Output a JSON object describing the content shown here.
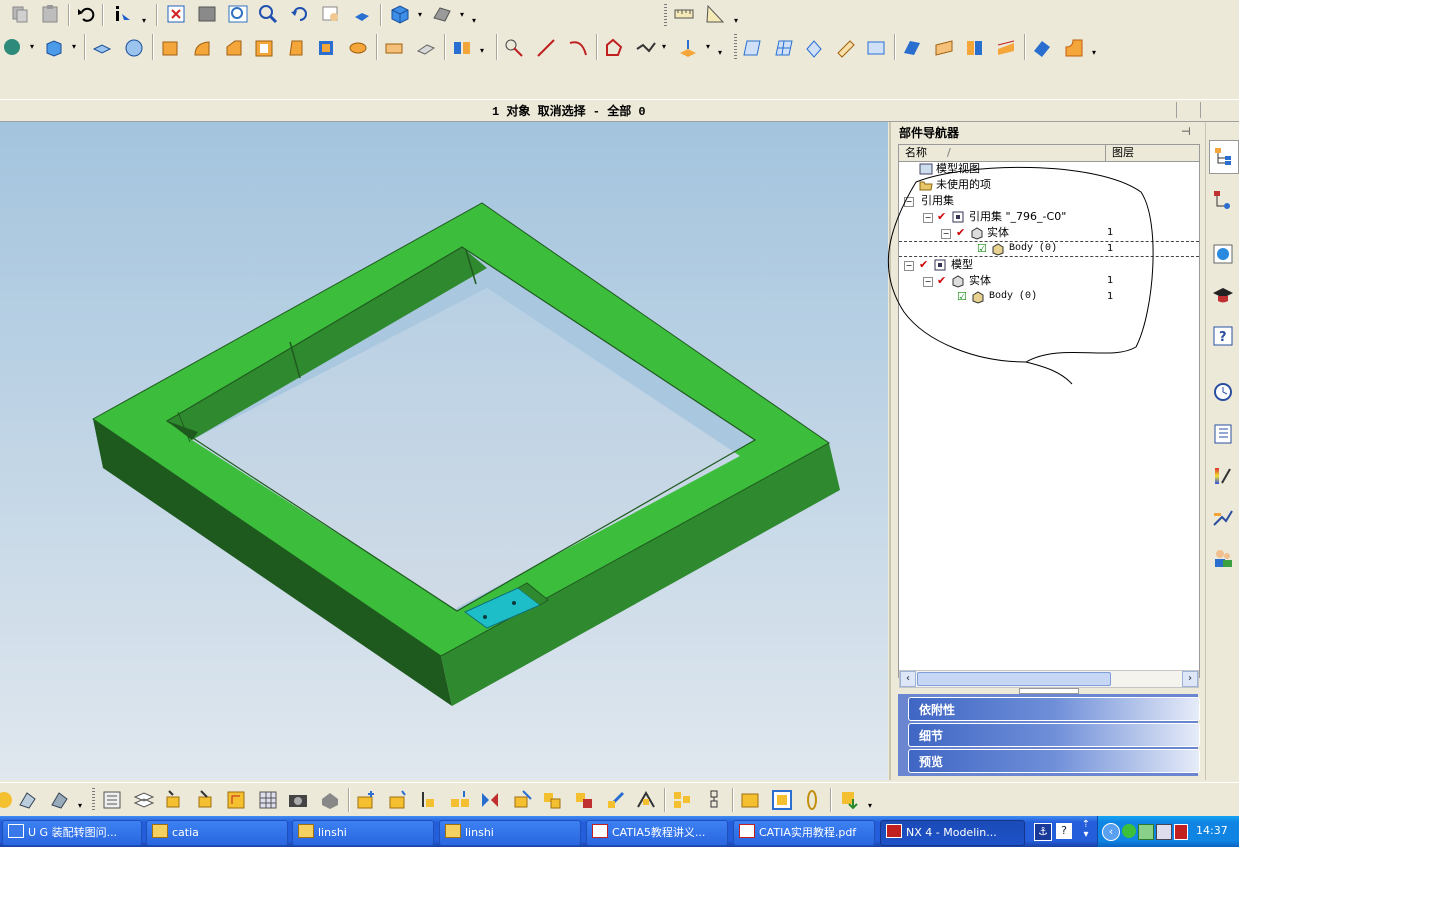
{
  "status_bar": {
    "message": "1 对象 取消选择 - 全部 0"
  },
  "navigator": {
    "title": "部件导航器",
    "col_name": "名称",
    "col_sort": "/",
    "col_layer": "图层",
    "tree": [
      {
        "label": "模型视图",
        "count": ""
      },
      {
        "label": "未使用的项",
        "count": ""
      },
      {
        "label": "引用集",
        "count": ""
      },
      {
        "label": "引用集 \"_796_-C0\"",
        "count": ""
      },
      {
        "label": "实体",
        "count": "1"
      },
      {
        "label": "Body (0)",
        "count": "1"
      },
      {
        "label": "模型",
        "count": ""
      },
      {
        "label": "实体",
        "count": "1"
      },
      {
        "label": "Body (0)",
        "count": "1"
      }
    ],
    "panels": {
      "dependencies": "依附性",
      "details": "细节",
      "preview": "预览"
    }
  },
  "taskbar": {
    "tasks": [
      {
        "label": "U G 装配转图问..."
      },
      {
        "label": "catia"
      },
      {
        "label": "linshi"
      },
      {
        "label": "linshi"
      },
      {
        "label": "CATIA5教程讲义..."
      },
      {
        "label": "CATIA实用教程.pdf"
      },
      {
        "label": "NX 4 - Modelin..."
      }
    ],
    "clock": "14:37"
  },
  "colors": {
    "part_green": "#3cbe3c",
    "part_dark": "#1f5a1f",
    "face_highlight": "#1ebec8",
    "annotation_ink": "#000000"
  }
}
